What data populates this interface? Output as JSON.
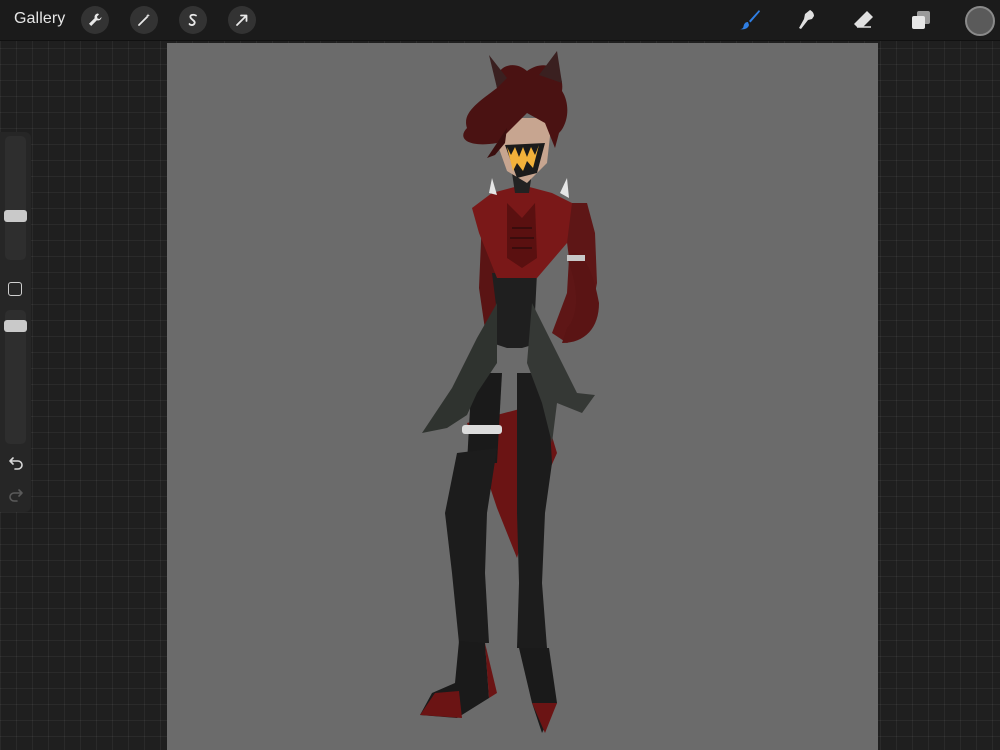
{
  "app": {
    "gallery_label": "Gallery"
  },
  "toolbar": {
    "left_actions": [
      "wrench-icon",
      "magic-wand-icon",
      "selection-icon",
      "transform-arrow-icon"
    ],
    "tools": [
      "brush-icon",
      "smudge-icon",
      "eraser-icon",
      "layers-icon"
    ],
    "active_tool": "brush-icon",
    "accent_color": "#2f7fe5",
    "current_color": "#5a5a5a"
  },
  "sidebar": {
    "brush_size_level": 0.7,
    "opacity_level": 0.85,
    "controls": [
      "modify-button",
      "undo-icon",
      "redo-icon"
    ]
  },
  "canvas": {
    "background_color": "#6b6b6b"
  }
}
